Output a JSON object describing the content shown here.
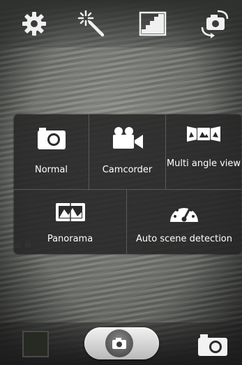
{
  "topbar": {
    "icons": [
      "settings-gear-icon",
      "magic-wand-icon",
      "exposure-icon",
      "switch-camera-icon"
    ]
  },
  "background_overlay_text": "≡ 6",
  "shooting_mode_menu": {
    "row1": [
      {
        "label": "Normal",
        "icon": "camera-icon"
      },
      {
        "label": "Camcorder",
        "icon": "camcorder-icon"
      },
      {
        "label": "Multi angle view",
        "icon": "multi-angle-icon"
      }
    ],
    "row2": [
      {
        "label": "Panorama",
        "icon": "panorama-icon"
      },
      {
        "label": "Auto scene detection",
        "icon": "gauge-icon"
      }
    ]
  },
  "bottombar": {
    "icons": [
      "gallery-thumbnail",
      "shutter-button",
      "camera-mode-icon"
    ]
  }
}
